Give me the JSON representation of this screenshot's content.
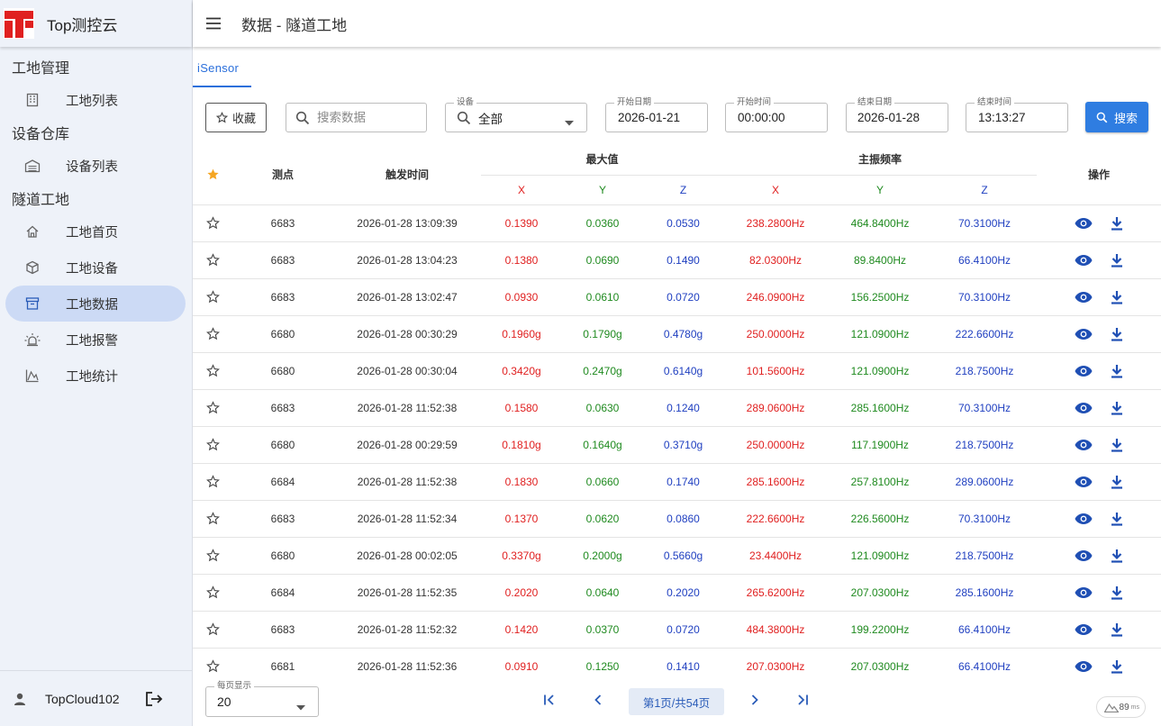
{
  "app": {
    "name": "Top测控云",
    "brand_color": "#e02020",
    "accent_color": "#2f7de1"
  },
  "sidebar": {
    "sections": [
      {
        "title": "工地管理",
        "items": [
          {
            "label": "工地列表",
            "icon": "building-grid-icon"
          }
        ]
      },
      {
        "title": "设备仓库",
        "items": [
          {
            "label": "设备列表",
            "icon": "warehouse-icon"
          }
        ]
      },
      {
        "title": "隧道工地",
        "items": [
          {
            "label": "工地首页",
            "icon": "home-icon"
          },
          {
            "label": "工地设备",
            "icon": "cube-icon"
          },
          {
            "label": "工地数据",
            "icon": "archive-box-icon",
            "active": true
          },
          {
            "label": "工地报警",
            "icon": "alarm-light-icon"
          },
          {
            "label": "工地统计",
            "icon": "area-chart-icon"
          }
        ]
      }
    ],
    "footer": {
      "user": "TopCloud102"
    }
  },
  "header": {
    "title": "数据 - 隧道工地"
  },
  "tabs": [
    {
      "label": "iSensor",
      "active": true
    }
  ],
  "filters": {
    "favorite_label": "收藏",
    "search_placeholder": "搜索数据",
    "device_legend": "设备",
    "device_value": "全部",
    "start_date_legend": "开始日期",
    "start_date": "2026-01-21",
    "start_time_legend": "开始时间",
    "start_time": "00:00:00",
    "end_date_legend": "结束日期",
    "end_date": "2026-01-28",
    "end_time_legend": "结束时间",
    "end_time": "13:13:27",
    "search_button": "搜索"
  },
  "table": {
    "headers": {
      "point": "测点",
      "trigger_time": "触发时间",
      "max_value": "最大值",
      "main_freq": "主振频率",
      "ops": "操作",
      "x": "X",
      "y": "Y",
      "z": "Z"
    },
    "rows": [
      {
        "point": "6683",
        "time": "2026-01-28 13:09:39",
        "mx": "0.1390",
        "my": "0.0360",
        "mz": "0.0530",
        "fx": "238.2800Hz",
        "fy": "464.8400Hz",
        "fz": "70.3100Hz"
      },
      {
        "point": "6683",
        "time": "2026-01-28 13:04:23",
        "mx": "0.1380",
        "my": "0.0690",
        "mz": "0.1490",
        "fx": "82.0300Hz",
        "fy": "89.8400Hz",
        "fz": "66.4100Hz"
      },
      {
        "point": "6683",
        "time": "2026-01-28 13:02:47",
        "mx": "0.0930",
        "my": "0.0610",
        "mz": "0.0720",
        "fx": "246.0900Hz",
        "fy": "156.2500Hz",
        "fz": "70.3100Hz"
      },
      {
        "point": "6680",
        "time": "2026-01-28 00:30:29",
        "mx": "0.1960g",
        "my": "0.1790g",
        "mz": "0.4780g",
        "fx": "250.0000Hz",
        "fy": "121.0900Hz",
        "fz": "222.6600Hz"
      },
      {
        "point": "6680",
        "time": "2026-01-28 00:30:04",
        "mx": "0.3420g",
        "my": "0.2470g",
        "mz": "0.6140g",
        "fx": "101.5600Hz",
        "fy": "121.0900Hz",
        "fz": "218.7500Hz"
      },
      {
        "point": "6683",
        "time": "2026-01-28 11:52:38",
        "mx": "0.1580",
        "my": "0.0630",
        "mz": "0.1240",
        "fx": "289.0600Hz",
        "fy": "285.1600Hz",
        "fz": "70.3100Hz"
      },
      {
        "point": "6680",
        "time": "2026-01-28 00:29:59",
        "mx": "0.1810g",
        "my": "0.1640g",
        "mz": "0.3710g",
        "fx": "250.0000Hz",
        "fy": "117.1900Hz",
        "fz": "218.7500Hz"
      },
      {
        "point": "6684",
        "time": "2026-01-28 11:52:38",
        "mx": "0.1830",
        "my": "0.0660",
        "mz": "0.1740",
        "fx": "285.1600Hz",
        "fy": "257.8100Hz",
        "fz": "289.0600Hz"
      },
      {
        "point": "6683",
        "time": "2026-01-28 11:52:34",
        "mx": "0.1370",
        "my": "0.0620",
        "mz": "0.0860",
        "fx": "222.6600Hz",
        "fy": "226.5600Hz",
        "fz": "70.3100Hz"
      },
      {
        "point": "6680",
        "time": "2026-01-28 00:02:05",
        "mx": "0.3370g",
        "my": "0.2000g",
        "mz": "0.5660g",
        "fx": "23.4400Hz",
        "fy": "121.0900Hz",
        "fz": "218.7500Hz"
      },
      {
        "point": "6684",
        "time": "2026-01-28 11:52:35",
        "mx": "0.2020",
        "my": "0.0640",
        "mz": "0.2020",
        "fx": "265.6200Hz",
        "fy": "207.0300Hz",
        "fz": "285.1600Hz"
      },
      {
        "point": "6683",
        "time": "2026-01-28 11:52:32",
        "mx": "0.1420",
        "my": "0.0370",
        "mz": "0.0720",
        "fx": "484.3800Hz",
        "fy": "199.2200Hz",
        "fz": "66.4100Hz"
      },
      {
        "point": "6681",
        "time": "2026-01-28 11:52:36",
        "mx": "0.0910",
        "my": "0.1250",
        "mz": "0.1410",
        "fx": "207.0300Hz",
        "fy": "207.0300Hz",
        "fz": "66.4100Hz"
      }
    ]
  },
  "pagination": {
    "per_page_legend": "每页显示",
    "per_page": "20",
    "page_info": "第1页/共54页"
  },
  "perf": {
    "value": "89",
    "unit": "ms"
  }
}
